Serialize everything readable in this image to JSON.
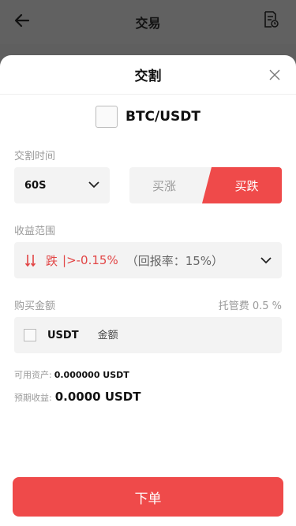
{
  "topbar": {
    "title": "交易",
    "back_icon": "arrow-left-icon",
    "record_icon": "order-record-icon"
  },
  "sheet": {
    "title": "交割",
    "pair": "BTC/USDT",
    "delivery_time_label": "交割时间",
    "delivery_time_value": "60S",
    "buy_up_label": "买涨",
    "buy_down_label": "买跌",
    "profit_range_label": "收益范围",
    "range_direction": "跌",
    "range_value": "|>-0.15%",
    "range_return": "（回报率：15%）",
    "purchase_amount_label": "购买金额",
    "custody_fee": "托管费 0.5 %",
    "currency": "USDT",
    "amount_placeholder": "金额",
    "available_label": "可用资产:",
    "available_value": "0.000000 USDT",
    "expected_label": "预期收益:",
    "expected_value": "0.0000 USDT",
    "submit_label": "下单"
  },
  "colors": {
    "accent_red": "#ef4a4a",
    "overlay": "#5f5f5f"
  }
}
